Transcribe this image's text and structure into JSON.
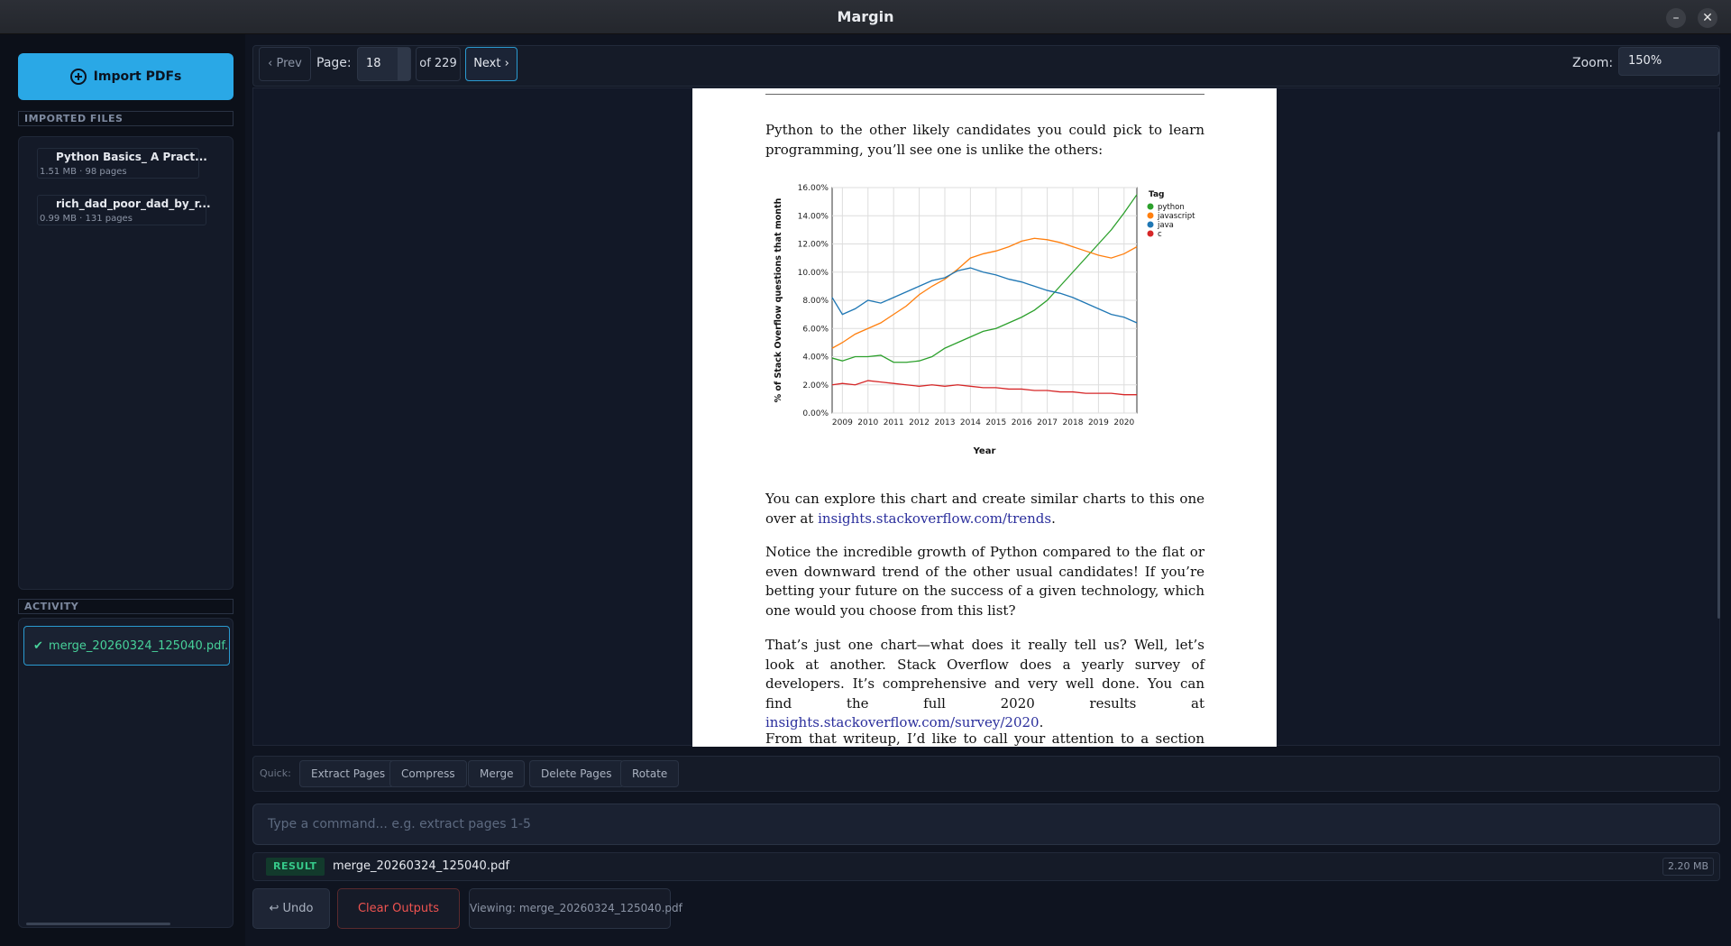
{
  "window": {
    "title": "Margin"
  },
  "sidebar": {
    "import_label": "Import PDFs",
    "files_header": "IMPORTED FILES",
    "files": [
      {
        "name": "Python Basics_ A Pract...",
        "meta": "1.51 MB · 98 pages"
      },
      {
        "name": "rich_dad_poor_dad_by_r...",
        "meta": "0.99 MB · 131 pages"
      }
    ],
    "activity_header": "ACTIVITY",
    "activity": [
      {
        "check": "✔",
        "label": "merge_20260324_125040.pdf..."
      }
    ]
  },
  "toolbar": {
    "prev": "‹ Prev",
    "page_label": "Page:",
    "page_value": "18",
    "of_total": "of 229",
    "next": "Next ›",
    "zoom_label": "Zoom:",
    "zoom_value": "150%"
  },
  "document": {
    "para1": "Python to the other likely candidates you could pick to learn programming, you’ll see one is unlike the others:",
    "para2_text": "You can explore this chart and create similar charts to this one over at ",
    "para2_link": "insights.stackoverflow.com/trends",
    "para2_end": ".",
    "para3": "Notice the incredible growth of Python compared to the flat or even downward trend of the other usual candidates! If you’re betting your future on the success of a given technology, which one would you choose from this list?",
    "para4_text": "That’s just one chart—what does it really tell us? Well, let’s look at another. Stack Overflow does a yearly survey of developers. It’s comprehensive and very well done. You can find the full 2020 results at ",
    "para4_link": "insights.stackoverflow.com/survey/2020",
    "para4_end": ".",
    "para5": "From that writeup, I’d like to call your attention to a section titled"
  },
  "chart_data": {
    "type": "line",
    "xlabel": "Year",
    "ylabel": "% of Stack Overflow questions that month",
    "legend_title": "Tag",
    "legend_position": "right",
    "grid": true,
    "xlim": [
      2008.6,
      2020.5
    ],
    "ylim": [
      0,
      16
    ],
    "x_ticks": [
      "2009",
      "2010",
      "2011",
      "2012",
      "2013",
      "2014",
      "2015",
      "2016",
      "2017",
      "2018",
      "2019",
      "2020"
    ],
    "y_ticks": [
      "0.00%",
      "2.00%",
      "4.00%",
      "6.00%",
      "8.00%",
      "10.00%",
      "12.00%",
      "14.00%",
      "16.00%"
    ],
    "x": [
      2008.6,
      2009,
      2009.5,
      2010,
      2010.5,
      2011,
      2011.5,
      2012,
      2012.5,
      2013,
      2013.5,
      2014,
      2014.5,
      2015,
      2015.5,
      2016,
      2016.5,
      2017,
      2017.5,
      2018,
      2018.5,
      2019,
      2019.5,
      2020,
      2020.5
    ],
    "series": [
      {
        "name": "python",
        "color": "#2ca02c",
        "values": [
          3.9,
          3.7,
          4.0,
          4.0,
          4.1,
          3.6,
          3.6,
          3.7,
          4.0,
          4.6,
          5.0,
          5.4,
          5.8,
          6.0,
          6.4,
          6.8,
          7.3,
          8.0,
          9.0,
          10.0,
          11.0,
          12.0,
          13.0,
          14.2,
          15.5
        ]
      },
      {
        "name": "javascript",
        "color": "#ff7f0e",
        "values": [
          4.6,
          5.0,
          5.6,
          6.0,
          6.4,
          7.0,
          7.6,
          8.4,
          9.0,
          9.5,
          10.2,
          11.0,
          11.3,
          11.5,
          11.8,
          12.2,
          12.4,
          12.3,
          12.1,
          11.8,
          11.5,
          11.2,
          11.0,
          11.3,
          11.8
        ]
      },
      {
        "name": "java",
        "color": "#1f77b4",
        "values": [
          8.2,
          7.0,
          7.4,
          8.0,
          7.8,
          8.2,
          8.6,
          9.0,
          9.4,
          9.6,
          10.1,
          10.3,
          10.0,
          9.8,
          9.5,
          9.3,
          9.0,
          8.7,
          8.5,
          8.2,
          7.8,
          7.4,
          7.0,
          6.8,
          6.4
        ]
      },
      {
        "name": "c",
        "color": "#d62728",
        "values": [
          2.0,
          2.1,
          2.0,
          2.3,
          2.2,
          2.1,
          2.0,
          1.9,
          2.0,
          1.9,
          2.0,
          1.9,
          1.8,
          1.8,
          1.7,
          1.7,
          1.6,
          1.6,
          1.5,
          1.5,
          1.4,
          1.4,
          1.4,
          1.3,
          1.3
        ]
      }
    ]
  },
  "quick": {
    "label": "Quick:",
    "buttons": [
      "Extract Pages",
      "Compress",
      "Merge",
      "Delete Pages",
      "Rotate"
    ]
  },
  "command": {
    "placeholder": "Type a command...  e.g. extract pages 1-5"
  },
  "result": {
    "badge": "RESULT",
    "filename": "merge_20260324_125040.pdf",
    "size": "2.20 MB"
  },
  "bottom": {
    "undo_icon": "↩",
    "undo": "Undo",
    "clear": "Clear Outputs",
    "viewing": "Viewing: merge_20260324_125040.pdf"
  }
}
